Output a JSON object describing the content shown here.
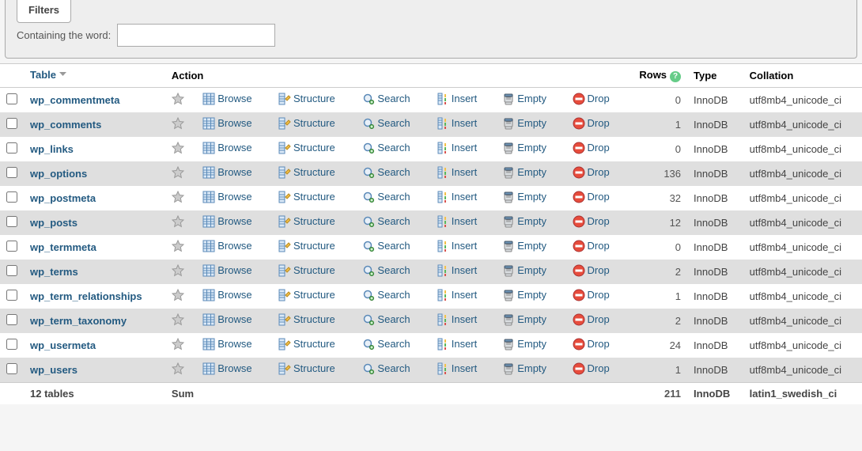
{
  "filters": {
    "tab": "Filters",
    "label": "Containing the word:",
    "value": ""
  },
  "headers": {
    "table": "Table",
    "action": "Action",
    "rows": "Rows",
    "type": "Type",
    "collation": "Collation"
  },
  "actions": {
    "browse": "Browse",
    "structure": "Structure",
    "search": "Search",
    "insert": "Insert",
    "empty": "Empty",
    "drop": "Drop"
  },
  "rows": [
    {
      "name": "wp_commentmeta",
      "rows": "0",
      "type": "InnoDB",
      "collation": "utf8mb4_unicode_ci"
    },
    {
      "name": "wp_comments",
      "rows": "1",
      "type": "InnoDB",
      "collation": "utf8mb4_unicode_ci"
    },
    {
      "name": "wp_links",
      "rows": "0",
      "type": "InnoDB",
      "collation": "utf8mb4_unicode_ci"
    },
    {
      "name": "wp_options",
      "rows": "136",
      "type": "InnoDB",
      "collation": "utf8mb4_unicode_ci"
    },
    {
      "name": "wp_postmeta",
      "rows": "32",
      "type": "InnoDB",
      "collation": "utf8mb4_unicode_ci"
    },
    {
      "name": "wp_posts",
      "rows": "12",
      "type": "InnoDB",
      "collation": "utf8mb4_unicode_ci"
    },
    {
      "name": "wp_termmeta",
      "rows": "0",
      "type": "InnoDB",
      "collation": "utf8mb4_unicode_ci"
    },
    {
      "name": "wp_terms",
      "rows": "2",
      "type": "InnoDB",
      "collation": "utf8mb4_unicode_ci"
    },
    {
      "name": "wp_term_relationships",
      "rows": "1",
      "type": "InnoDB",
      "collation": "utf8mb4_unicode_ci"
    },
    {
      "name": "wp_term_taxonomy",
      "rows": "2",
      "type": "InnoDB",
      "collation": "utf8mb4_unicode_ci"
    },
    {
      "name": "wp_usermeta",
      "rows": "24",
      "type": "InnoDB",
      "collation": "utf8mb4_unicode_ci"
    },
    {
      "name": "wp_users",
      "rows": "1",
      "type": "InnoDB",
      "collation": "utf8mb4_unicode_ci"
    }
  ],
  "summary": {
    "countLabel": "12 tables",
    "sum": "Sum",
    "rows": "211",
    "type": "InnoDB",
    "collation": "latin1_swedish_ci"
  },
  "tooltips": {
    "rowsHelp": "?"
  }
}
